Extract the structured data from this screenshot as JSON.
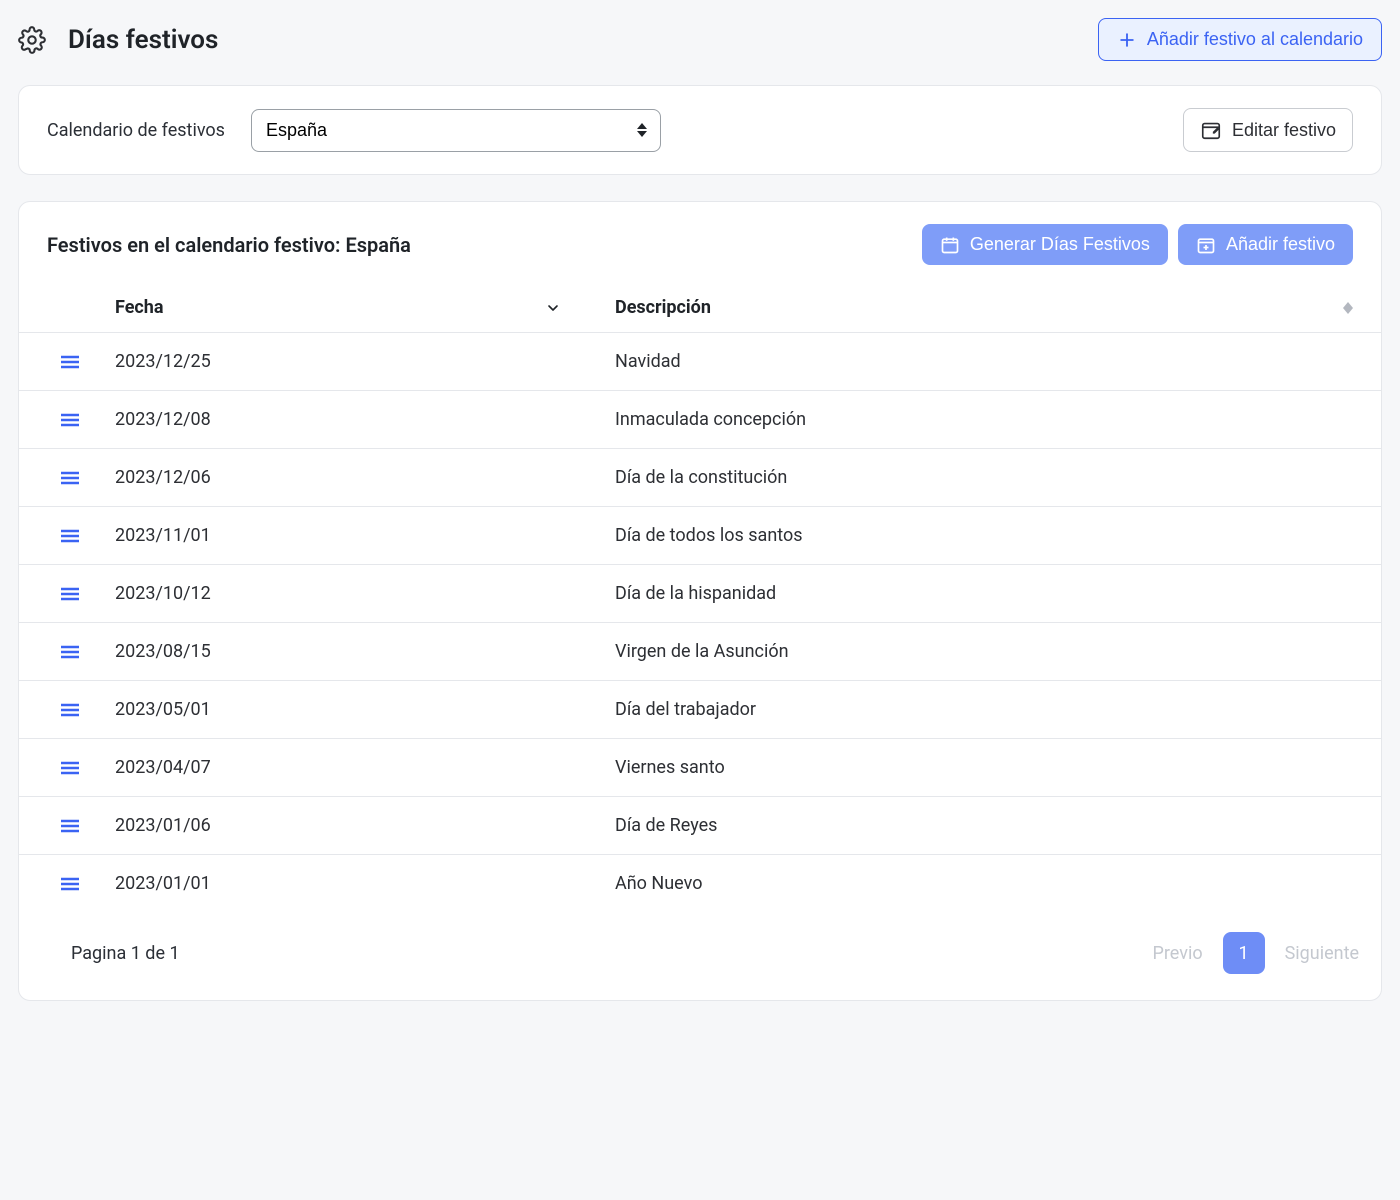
{
  "header": {
    "title": "Días festivos",
    "add_button": "Añadir festivo al calendario"
  },
  "selector": {
    "label": "Calendario de festivos",
    "value": "España",
    "edit_button": "Editar festivo"
  },
  "table": {
    "title": "Festivos en el calendario festivo: España",
    "generate_button": "Generar Días Festivos",
    "add_button": "Añadir festivo",
    "columns": {
      "fecha": "Fecha",
      "descripcion": "Descripción"
    },
    "rows": [
      {
        "fecha": "2023/12/25",
        "desc": "Navidad"
      },
      {
        "fecha": "2023/12/08",
        "desc": "Inmaculada concepción"
      },
      {
        "fecha": "2023/12/06",
        "desc": "Día de la constitución"
      },
      {
        "fecha": "2023/11/01",
        "desc": "Día de todos los santos"
      },
      {
        "fecha": "2023/10/12",
        "desc": "Día de la hispanidad"
      },
      {
        "fecha": "2023/08/15",
        "desc": "Virgen de la Asunción"
      },
      {
        "fecha": "2023/05/01",
        "desc": "Día del trabajador"
      },
      {
        "fecha": "2023/04/07",
        "desc": "Viernes santo"
      },
      {
        "fecha": "2023/01/06",
        "desc": "Día de Reyes"
      },
      {
        "fecha": "2023/01/01",
        "desc": "Año Nuevo"
      }
    ]
  },
  "pagination": {
    "info": "Pagina 1 de 1",
    "prev": "Previo",
    "current": "1",
    "next": "Siguiente"
  }
}
